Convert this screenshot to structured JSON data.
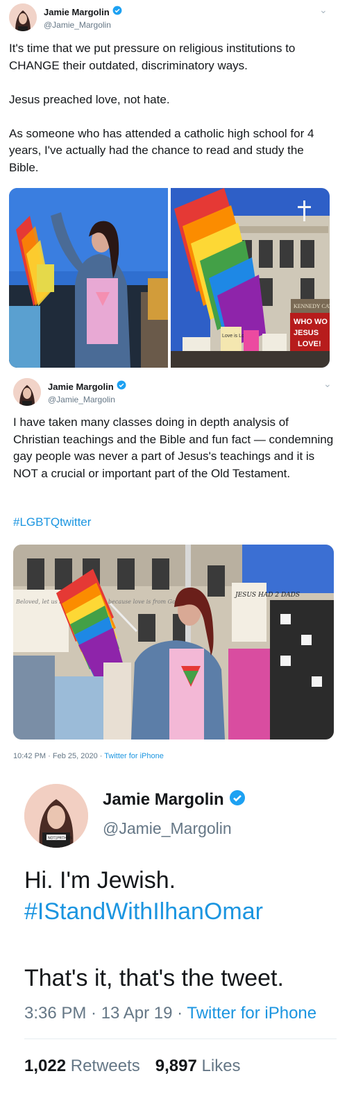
{
  "tweet1": {
    "author_name": "Jamie Margolin",
    "author_handle": "@Jamie_Margolin",
    "text": "It's time that we put pressure on religious institutions to CHANGE their outdated, discriminatory ways.\n\nJesus preached love, not hate.\n\nAs someone who has attended a catholic high school for 4 years, I've actually had the chance to read and study the Bible.",
    "media_left": {
      "sign_text": "",
      "icon": "photo-protester-rainbow-flag"
    },
    "media_right": {
      "building_sign": "KENNEDY CATHO",
      "banner_line1": "WHO WO",
      "banner_line2": "JESUS",
      "banner_line3": "LOVE!",
      "sign_left": "Love is Love"
    }
  },
  "tweet2": {
    "author_name": "Jamie Margolin",
    "author_handle": "@Jamie_Margolin",
    "text": "I have taken many classes doing in depth analysis of Christian teachings and the Bible and fun fact — condemning gay people was never a part of Jesus's teachings and it is NOT a crucial or important part of the Old Testament.",
    "hashtag": "#LGBTQtwitter",
    "media": {
      "sign_left": "Beloved, let us love one another because love is from God",
      "sign_right": "JESUS HAD 2 DADS"
    },
    "timestamp": "10:42 PM · Feb 25, 2020 · ",
    "source": "Twitter for iPhone"
  },
  "tweet3": {
    "author_name": "Jamie Margolin",
    "author_handle": "@Jamie_Margolin",
    "avatar_caption": "NOT1PRTHIRS",
    "line1": "Hi. I'm Jewish.",
    "hashtag": "#IStandWithIlhanOmar",
    "line3": "That's it, that's the tweet.",
    "timestamp": "3:36 PM · 13 Apr 19 · ",
    "source": "Twitter for iPhone",
    "retweets_count": "1,022",
    "retweets_label": "Retweets",
    "likes_count": "9,897",
    "likes_label": "Likes"
  },
  "colors": {
    "link": "#1b95e0",
    "verified": "#1da1f2",
    "secondary_text": "#657786"
  }
}
